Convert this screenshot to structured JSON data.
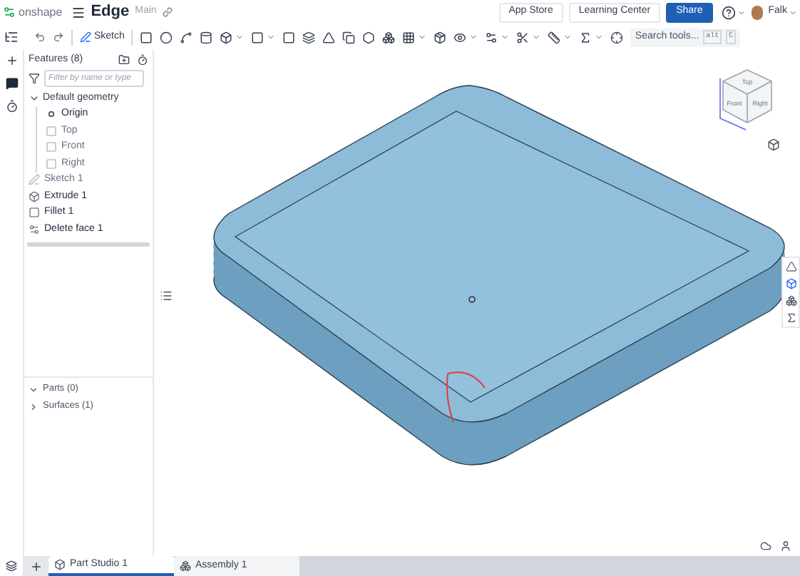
{
  "app": {
    "logo": "onshape",
    "document": "Edge",
    "workspace": "Main"
  },
  "header_buttons": [
    {
      "label": "App Store",
      "kind": "plain"
    },
    {
      "label": "Learning Center",
      "kind": "plain"
    },
    {
      "label": "Share",
      "kind": "primary"
    }
  ],
  "user": {
    "name": "Falk"
  },
  "toolbar": {
    "sketch_label": "Sketch",
    "search_placeholder": "Search tools...",
    "shortcut_keys": [
      "alt",
      "C"
    ]
  },
  "features": {
    "title": "Features (8)",
    "filter_placeholder": "Filter by name or type",
    "items": [
      {
        "label": "Default geometry",
        "kind": "group",
        "expanded": true,
        "children": [
          {
            "label": "Origin",
            "kind": "origin",
            "hidden": false
          },
          {
            "label": "Top",
            "kind": "plane",
            "hidden": true
          },
          {
            "label": "Front",
            "kind": "plane",
            "hidden": true
          },
          {
            "label": "Right",
            "kind": "plane",
            "hidden": true
          }
        ]
      },
      {
        "label": "Sketch 1",
        "kind": "sketch",
        "hidden": true
      },
      {
        "label": "Extrude 1",
        "kind": "extrude",
        "hidden": false
      },
      {
        "label": "Fillet 1",
        "kind": "fillet",
        "hidden": false
      },
      {
        "label": "Delete face 1",
        "kind": "delete",
        "hidden": false
      }
    ]
  },
  "parts": [
    {
      "label": "Parts (0)",
      "expanded": true
    },
    {
      "label": "Surfaces (1)",
      "expanded": false
    }
  ],
  "view_cube": {
    "faces": [
      "Top",
      "Front",
      "Right"
    ]
  },
  "tabs": [
    {
      "label": "Part Studio 1",
      "kind": "part_studio",
      "selected": true
    },
    {
      "label": "Assembly 1",
      "kind": "assembly",
      "selected": false
    }
  ]
}
